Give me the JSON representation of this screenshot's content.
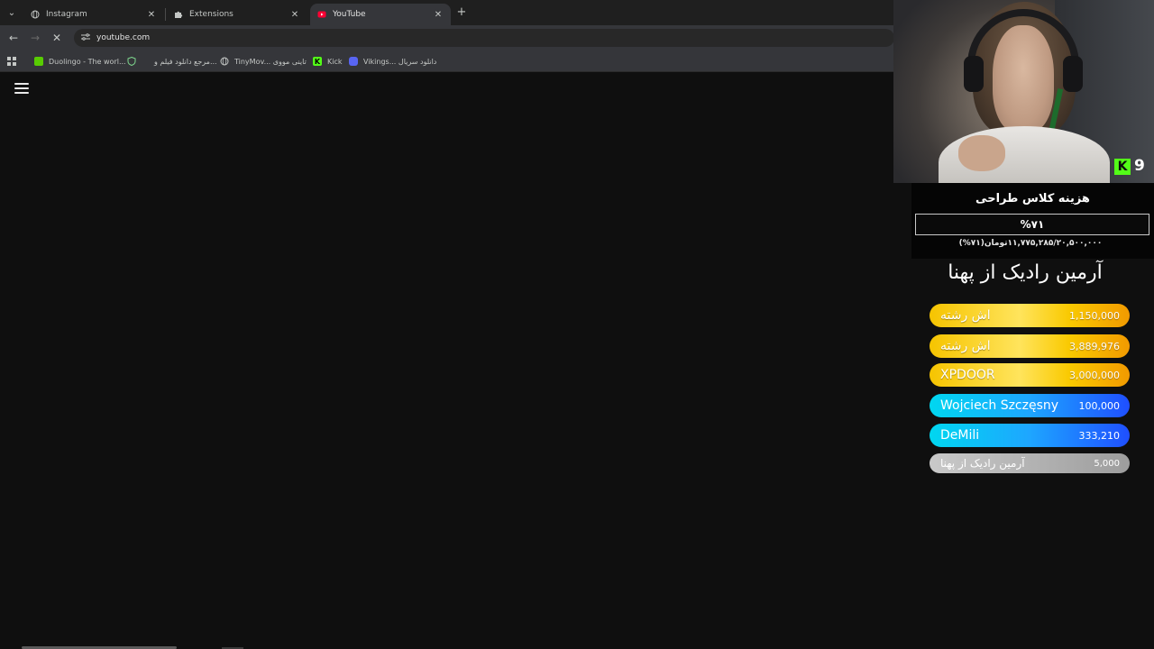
{
  "browser": {
    "tabs": [
      {
        "title": "Instagram",
        "icon": "globe-icon",
        "active": false
      },
      {
        "title": "Extensions",
        "icon": "puzzle-icon",
        "active": false
      },
      {
        "title": "YouTube",
        "icon": "youtube-icon",
        "active": true
      }
    ],
    "new_tab_glyph": "+",
    "url": "youtube.com",
    "bookmarks": [
      {
        "label": "Duolingo - The worl...",
        "icon": "duolingo-icon"
      },
      {
        "label": "مرجع دانلود فیلم و...",
        "icon": "shield-icon"
      },
      {
        "label": "TinyMov... تاینی مووی",
        "icon": "globe-icon"
      },
      {
        "label": "Kick",
        "icon": "kick-icon"
      },
      {
        "label": "Vikings... دانلود سریال",
        "icon": "discord-icon"
      }
    ]
  },
  "overlay": {
    "kick_badge": "K",
    "viewer_count": "9",
    "goal": {
      "title": "هزینه کلاس طراحی",
      "percent_label": "%۷۱",
      "amount_label": "۱۱,۷۷۵,۲۸۵/۲۰,۵۰۰,۰۰۰تومان(۷۱%)",
      "progress": 0.71
    },
    "top_donor_title": "آرمین رادیک از پهنا",
    "donors": [
      {
        "name": "اش رشته",
        "amount": "1,150,000",
        "style": "gold"
      },
      {
        "name": "اش رشته",
        "amount": "3,889,976",
        "style": "gold"
      },
      {
        "name": "XPDOOR",
        "amount": "3,000,000",
        "style": "gold"
      },
      {
        "name": "Wojciech Szczęsny",
        "amount": "100,000",
        "style": "blue"
      },
      {
        "name": "DeMili",
        "amount": "333,210",
        "style": "blue"
      },
      {
        "name": "آرمین رادیک از پهنا",
        "amount": "5,000",
        "style": "gray"
      }
    ],
    "colors": {
      "kick_green": "#53fc18",
      "gold": "#f6c400",
      "blue": "#1ea6ff",
      "gray": "#b0b0b0"
    }
  }
}
